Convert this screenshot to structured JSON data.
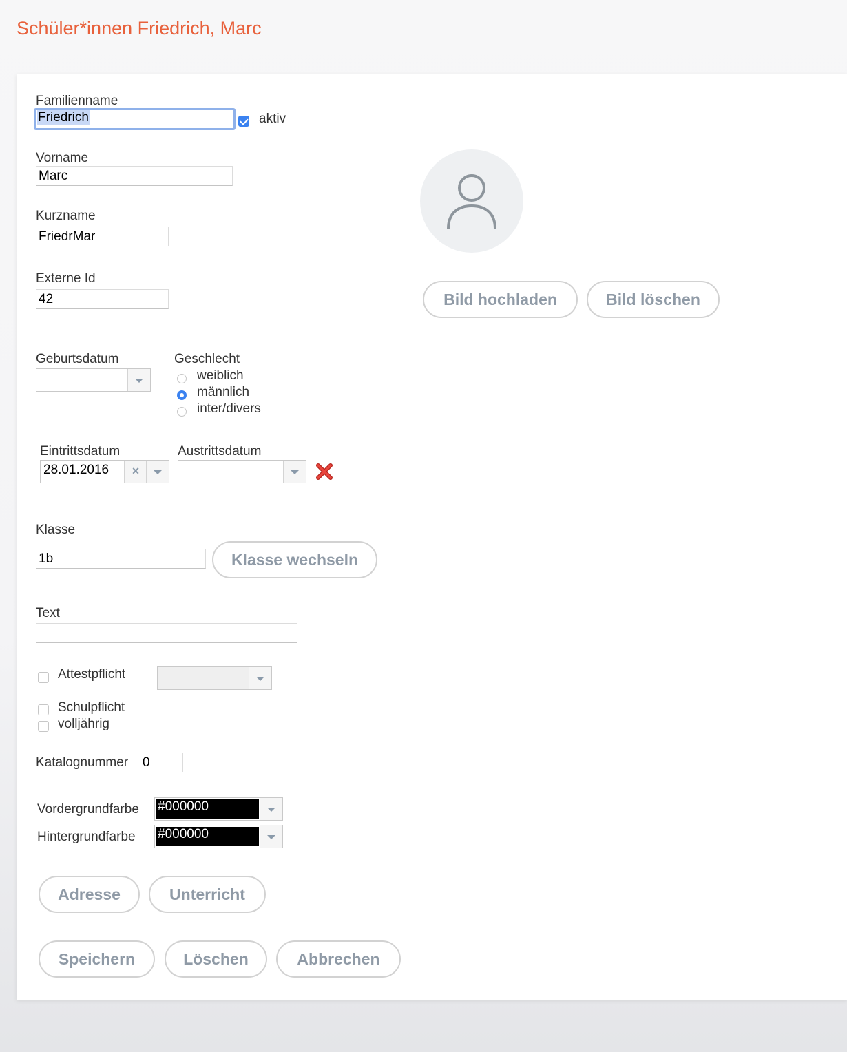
{
  "page": {
    "title": "Schüler*innen Friedrich, Marc"
  },
  "form": {
    "familienname": {
      "label": "Familienname",
      "value": "Friedrich"
    },
    "aktiv": {
      "label": "aktiv",
      "checked": true
    },
    "vorname": {
      "label": "Vorname",
      "value": "Marc"
    },
    "kurzname": {
      "label": "Kurzname",
      "value": "FriedrMar"
    },
    "externe_id": {
      "label": "Externe Id",
      "value": "42"
    },
    "geburtsdatum": {
      "label": "Geburtsdatum",
      "value": ""
    },
    "geschlecht": {
      "label": "Geschlecht",
      "options": [
        "weiblich",
        "männlich",
        "inter/divers"
      ],
      "selected": "männlich"
    },
    "eintrittsdatum": {
      "label": "Eintrittsdatum",
      "value": "28.01.2016"
    },
    "austrittsdatum": {
      "label": "Austrittsdatum",
      "value": ""
    },
    "klasse": {
      "label": "Klasse",
      "value": "1b",
      "button": "Klasse wechseln"
    },
    "text": {
      "label": "Text",
      "value": ""
    },
    "attestpflicht": {
      "label": "Attestpflicht",
      "checked": false
    },
    "schulpflicht": {
      "label": "Schulpflicht",
      "checked": false
    },
    "volljaehrig": {
      "label": "volljährig",
      "checked": false
    },
    "katalognummer": {
      "label": "Katalognummer",
      "value": "0"
    },
    "vordergrundfarbe": {
      "label": "Vordergrundfarbe",
      "value": "#000000"
    },
    "hintergrundfarbe": {
      "label": "Hintergrundfarbe",
      "value": "#000000"
    }
  },
  "photo": {
    "upload_label": "Bild hochladen",
    "delete_label": "Bild löschen"
  },
  "buttons": {
    "adresse": "Adresse",
    "unterricht": "Unterricht",
    "speichern": "Speichern",
    "loeschen": "Löschen",
    "abbrechen": "Abbrechen"
  },
  "colors": {
    "accent": "#e8613c",
    "checkbox": "#3b82f0",
    "button_text": "#8f9aa6",
    "clear_icon": "#d9342b"
  },
  "icons": {
    "avatar": "user-placeholder-icon",
    "clear": "red-x-icon",
    "dropdown": "chevron-down-icon"
  }
}
